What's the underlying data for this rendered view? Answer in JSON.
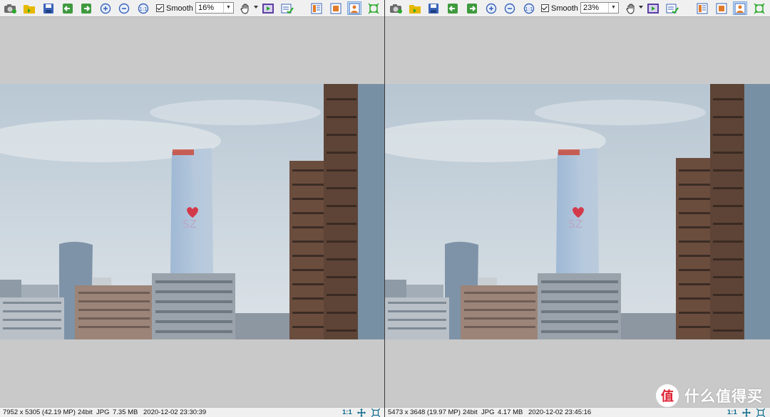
{
  "toolbar_icons": {
    "camera": "camera-icon",
    "open": "open-folder-icon",
    "save": "save-icon",
    "prev": "previous-image-icon",
    "next": "next-image-icon",
    "zoom_in": "zoom-in-icon",
    "zoom_out": "zoom-out-icon",
    "actual": "actual-size-icon",
    "hand": "hand-pan-icon",
    "slideshow": "slideshow-icon",
    "edit": "edit-icon",
    "layout1": "layout-icon",
    "layout2": "layout-icon",
    "view_active": "image-view-icon",
    "fit": "fit-window-icon"
  },
  "left": {
    "smooth_label": "Smooth",
    "zoom_value": "16%",
    "status": {
      "dimensions": "7952 x 5305 (42.19 MP)",
      "bitdepth": "24bit",
      "format": "JPG",
      "size": "7.35 MB",
      "datetime": "2020-12-02 23:30:39",
      "ratio": "1:1"
    }
  },
  "right": {
    "smooth_label": "Smooth",
    "zoom_value": "23%",
    "status": {
      "dimensions": "5473 x 3648 (19.97 MP)",
      "bitdepth": "24bit",
      "format": "JPG",
      "size": "4.17 MB",
      "datetime": "2020-12-02 23:45:16",
      "ratio": "1:1"
    }
  },
  "watermark": {
    "symbol": "值",
    "text": "什么值得买"
  },
  "photo_text": {
    "tower_logo": "SZ"
  },
  "colors": {
    "toolbar_bg": "#f0f0f0",
    "active_button": "#cfe3f8",
    "ratio_text": "#0a6a8a",
    "canvas_bg": "#c9c9c9"
  }
}
